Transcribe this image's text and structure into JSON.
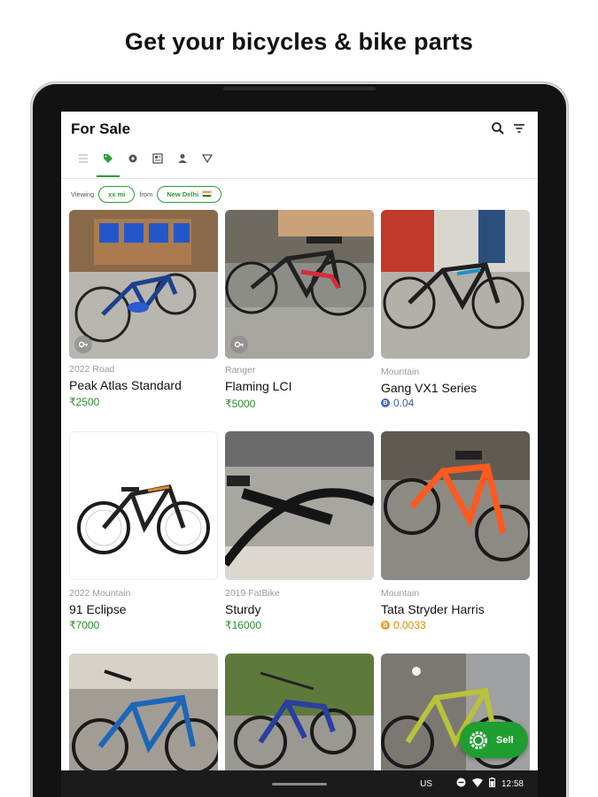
{
  "headline": "Get your bicycles & bike parts",
  "appbar": {
    "title": "For Sale",
    "icons": [
      "search-icon",
      "filter-icon"
    ],
    "tabs": [
      {
        "icon": "list-icon",
        "active": false
      },
      {
        "icon": "tag-icon",
        "active": true
      },
      {
        "icon": "bike-part-icon",
        "active": false
      },
      {
        "icon": "newspaper-icon",
        "active": false
      },
      {
        "icon": "person-icon",
        "active": false
      },
      {
        "icon": "triangle-icon",
        "active": false
      }
    ]
  },
  "filter": {
    "viewing_label": "Viewing",
    "distance": "xx mi",
    "from_label": "from",
    "location": "New Delhi"
  },
  "listings": [
    {
      "subtitle": "2022 Road",
      "name": "Peak Atlas Standard",
      "price": "₹2500",
      "price_type": "green",
      "badge": true
    },
    {
      "subtitle": "Ranger",
      "name": "Flaming LCI",
      "price": "₹5000",
      "price_type": "green",
      "badge": true
    },
    {
      "subtitle": "Mountain",
      "name": "Gang VX1 Series",
      "price": "0.04",
      "price_type": "blue",
      "badge": false
    },
    {
      "subtitle": "2022 Mountain",
      "name": "91 Eclipse",
      "price": "₹7000",
      "price_type": "green",
      "badge": false
    },
    {
      "subtitle": "2019 FatBike",
      "name": "Sturdy",
      "price": "₹16000",
      "price_type": "green",
      "badge": false
    },
    {
      "subtitle": "Mountain",
      "name": "Tata Stryder Harris",
      "price": "0.0033",
      "price_type": "orange",
      "badge": false
    }
  ],
  "fab": {
    "label": "Sell"
  },
  "status_bar": {
    "locale": "US",
    "time": "12:58"
  },
  "colors": {
    "accent": "#2e9b3c",
    "fab": "#1e9e2e",
    "price_green": "#2e8b2e",
    "price_blue": "#3d5ba8",
    "price_orange": "#e58a00"
  }
}
